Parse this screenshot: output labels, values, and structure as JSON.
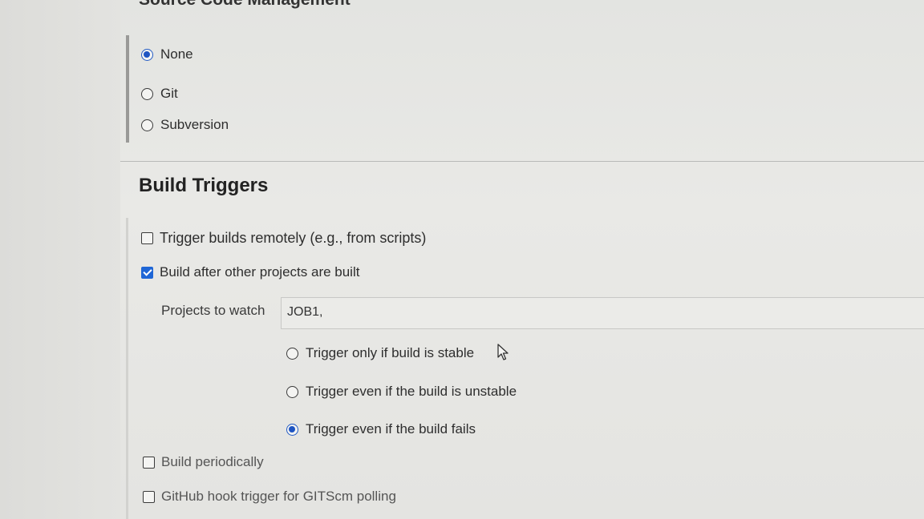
{
  "scm": {
    "title": "Source Code Management",
    "options": [
      {
        "label": "None",
        "selected": true
      },
      {
        "label": "Git",
        "selected": false
      },
      {
        "label": "Subversion",
        "selected": false
      }
    ]
  },
  "build_triggers": {
    "title": "Build Triggers",
    "trigger_remote": {
      "label": "Trigger builds remotely (e.g., from scripts)",
      "checked": false
    },
    "build_after": {
      "label": "Build after other projects are built",
      "checked": true
    },
    "projects_to_watch": {
      "label": "Projects to watch",
      "value": "JOB1,"
    },
    "trigger_options": [
      {
        "label": "Trigger only if build is stable",
        "selected": false
      },
      {
        "label": "Trigger even if the build is unstable",
        "selected": false
      },
      {
        "label": "Trigger even if the build fails",
        "selected": true
      }
    ],
    "build_periodically": {
      "label": "Build periodically",
      "checked": false
    },
    "github_hook": {
      "label": "GitHub hook trigger for GITScm polling",
      "checked": false
    }
  },
  "icons": {
    "cursor": "mouse-pointer-icon"
  },
  "colors": {
    "accent": "#1f55c2",
    "checkbox_checked": "#1f66d6"
  }
}
